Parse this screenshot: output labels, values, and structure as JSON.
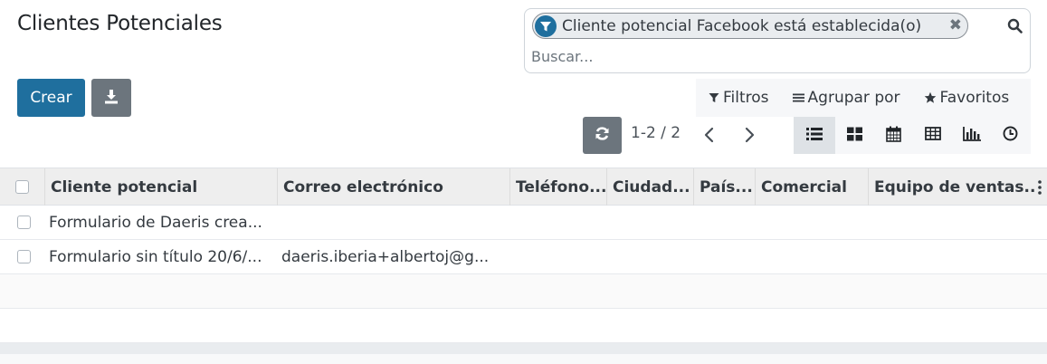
{
  "page": {
    "title": "Clientes Potenciales"
  },
  "search": {
    "facet_label": "Cliente potencial Facebook está establecida(o)",
    "facet_icon": "filter-icon",
    "placeholder": "Buscar..."
  },
  "toolbar": {
    "create_label": "Crear",
    "download_icon": "download-icon",
    "refresh_icon": "refresh-icon"
  },
  "filters": {
    "filters_label": "Filtros",
    "groupby_label": "Agrupar por",
    "favorites_label": "Favoritos"
  },
  "pager": {
    "text": "1-2 / 2"
  },
  "views": [
    "list-view-icon",
    "kanban-view-icon",
    "calendar-view-icon",
    "pivot-view-icon",
    "graph-view-icon",
    "activity-view-icon"
  ],
  "table": {
    "columns": [
      "Cliente potencial",
      "Correo electrónico",
      "Teléfono...",
      "Ciudad...",
      "País...",
      "Comercial",
      "Equipo de ventas..."
    ],
    "rows": [
      [
        "Formulario de Daeris crea...",
        "",
        "",
        "",
        "",
        "",
        ""
      ],
      [
        "Formulario sin título 20/6/...",
        "daeris.iberia+albertoj@g...",
        "",
        "",
        "",
        "",
        ""
      ]
    ]
  },
  "colors": {
    "primary": "#1f6f9e",
    "secondary": "#6c757d"
  }
}
